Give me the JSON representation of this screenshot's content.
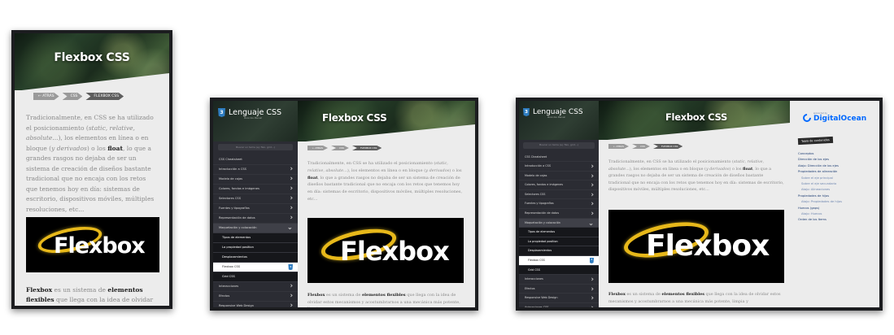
{
  "page_title": "Flexbox CSS",
  "breadcrumb": [
    "⇠ ATRÁS",
    "CSS",
    "FLEXBOX CSS"
  ],
  "intro": {
    "p1": "Tradicionalmente, en CSS se ha utilizado el posicionamiento (",
    "em1": "static, relative, absolute...",
    "p2": "), los elementos en línea o en bloque (",
    "em2": "y derivados",
    "p3": ") o los ",
    "strong": "float",
    "p4": ", lo que a grandes rasgos no dejaba de ser un sistema de creación de diseños bastante tradicional que no encaja con los retos que tenemos hoy en día: sistemas de escritorio, dispositivos móviles, múltiples resoluciones, etc..."
  },
  "logo_word": "Flexbox",
  "second_para": {
    "b1": "Flexbox",
    "t1": " es un sistema de ",
    "b2": "elementos flexibles",
    "t2": " que llega con la idea de olvidar estos mecanismos y acostumbrarnos a una mecánica más potente, limpia y"
  },
  "sidebar": {
    "brand": "Lenguaje CSS",
    "brand_sub": "Manz.dev Manual",
    "search_placeholder": "Buscar un tema (ej: flex, grid...)",
    "items": [
      {
        "label": "CSS Cheatsheet",
        "chev": ""
      },
      {
        "label": "Introducción a CSS",
        "chev": "›"
      },
      {
        "label": "Modelo de cajas",
        "chev": "›"
      },
      {
        "label": "Colores, fondos e imágenes",
        "chev": "›"
      },
      {
        "label": "Selectores CSS",
        "chev": "›"
      },
      {
        "label": "Fuentes y tipografías",
        "chev": "›"
      },
      {
        "label": "Representación de datos",
        "chev": "›"
      },
      {
        "label": "Maquetación y colocación",
        "chev": "⌄"
      },
      {
        "label": "Tipos de elementos",
        "chev": ""
      },
      {
        "label": "La propiedad position",
        "chev": ""
      },
      {
        "label": "Desplazamientos",
        "chev": ""
      },
      {
        "label": "Flexbox CSS",
        "chev": "3"
      },
      {
        "label": "Grid CSS",
        "chev": ""
      },
      {
        "label": "Interacciones",
        "chev": "›"
      },
      {
        "label": "Efectos",
        "chev": "›"
      },
      {
        "label": "Responsive Web Design",
        "chev": "›"
      },
      {
        "label": "Animaciones CSS",
        "chev": "›"
      }
    ]
  },
  "sponsor": {
    "small": "sponsored by",
    "name": "DigitalOcean"
  },
  "toc": {
    "title": "Tabla de contenidos",
    "items": [
      {
        "label": "Conceptos",
        "level": "main"
      },
      {
        "label": "Dirección de los ejes",
        "level": "main"
      },
      {
        "label": "Atajo: Dirección de los ejes",
        "level": "main"
      },
      {
        "label": "Propiedades de alineación",
        "level": "main"
      },
      {
        "label": "Sobre el eje principal",
        "level": "sub"
      },
      {
        "label": "Sobre el eje secundario",
        "level": "sub"
      },
      {
        "label": "Atajo: Alineaciones",
        "level": "sub"
      },
      {
        "label": "Propiedades de hijos",
        "level": "main"
      },
      {
        "label": "Atajo: Propiedades de hijos",
        "level": "sub"
      },
      {
        "label": "Huecos (gaps)",
        "level": "main"
      },
      {
        "label": "Atajo: Huecos",
        "level": "sub"
      },
      {
        "label": "Orden de los ítems",
        "level": "main"
      }
    ]
  }
}
